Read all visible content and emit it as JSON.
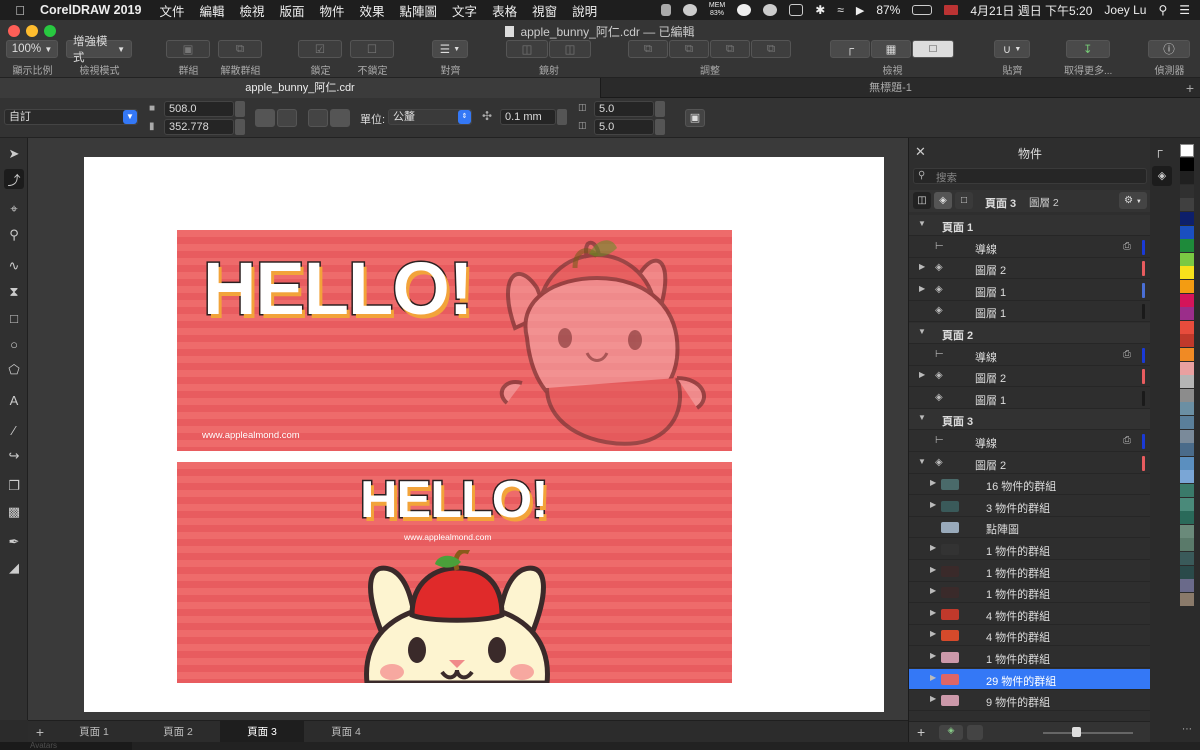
{
  "menubar": {
    "app_name": "CorelDRAW 2019",
    "menus": [
      "文件",
      "編輯",
      "檢視",
      "版面",
      "物件",
      "效果",
      "點陣圖",
      "文字",
      "表格",
      "視窗",
      "說明"
    ],
    "battery": "87%",
    "clock": "4月21日 週日 下午5:20",
    "user": "Joey Lu",
    "mem_label": "MEM",
    "mem_value": "83%"
  },
  "window": {
    "title": "apple_bunny_阿仁.cdr — 已編輯"
  },
  "toolbar": {
    "zoom_value": "100%",
    "zoom_label": "顯示比例",
    "view_mode_value": "增強模式",
    "view_mode_label": "檢視模式",
    "group_label": "群組",
    "ungroup_label": "解散群組",
    "lock_label": "鎖定",
    "unlock_label": "不鎖定",
    "align_label": "對齊",
    "mirror_label": "鏡射",
    "adjust_label": "調整",
    "view_label": "檢視",
    "snap_label": "貼齊",
    "get_more_label": "取得更多...",
    "inspector_label": "偵測器"
  },
  "doc_tabs": [
    "apple_bunny_阿仁.cdr",
    "無標題-1"
  ],
  "propbar": {
    "preset": "自訂",
    "width": "508.0",
    "height": "352.778",
    "unit_label": "單位:",
    "unit_value": "公釐",
    "nudge": "0.1 mm",
    "dup_x": "5.0",
    "dup_y": "5.0"
  },
  "canvas": {
    "banner1": {
      "hello": "HELLO!",
      "url": "www.applealmond.com"
    },
    "banner2": {
      "hello": "HELLO!",
      "url": "www.applealmond.com"
    }
  },
  "page_tabs": [
    "頁面 1",
    "頁面 2",
    "頁面 3",
    "頁面 4"
  ],
  "page_tabs_active": 2,
  "status": {
    "avatar_label": "Avatars"
  },
  "panel": {
    "title": "物件",
    "search_placeholder": "搜索",
    "current_page": "頁面 3",
    "current_layer": "圖層 2",
    "rows": [
      {
        "type": "page",
        "label": "頁面 1"
      },
      {
        "type": "guide",
        "label": "導線",
        "color": "#1a3ad6"
      },
      {
        "type": "layer",
        "label": "圖層 2",
        "expand": true,
        "color": "#e85c5f"
      },
      {
        "type": "layer",
        "label": "圖層 1",
        "expand": true,
        "color": "#4a6fd6"
      },
      {
        "type": "layer",
        "label": "圖層 1",
        "expand": false,
        "color": "#1a1a1a"
      },
      {
        "type": "page",
        "label": "頁面 2"
      },
      {
        "type": "guide",
        "label": "導線",
        "color": "#1a3ad6"
      },
      {
        "type": "layer",
        "label": "圖層 2",
        "expand": true,
        "color": "#e85c5f"
      },
      {
        "type": "layer",
        "label": "圖層 1",
        "expand": false,
        "color": "#1a1a1a"
      },
      {
        "type": "page",
        "label": "頁面 3"
      },
      {
        "type": "guide",
        "label": "導線",
        "color": "#1a3ad6"
      },
      {
        "type": "layer-open",
        "label": "圖層 2",
        "color": "#e85c5f"
      },
      {
        "type": "obj",
        "label": "16 物件的群組",
        "thumb": "#4a6a6a"
      },
      {
        "type": "obj",
        "label": "3 物件的群組",
        "thumb": "#3a5a5a"
      },
      {
        "type": "obj-noexp",
        "label": "點陣圖",
        "thumb": "#9ab"
      },
      {
        "type": "obj",
        "label": "1 物件的群組",
        "thumb": "#333"
      },
      {
        "type": "obj",
        "label": "1 物件的群組",
        "thumb": "#3a2a2a"
      },
      {
        "type": "obj",
        "label": "1 物件的群組",
        "thumb": "#3a2a2a"
      },
      {
        "type": "obj",
        "label": "4 物件的群組",
        "thumb": "#c0392b"
      },
      {
        "type": "obj",
        "label": "4 物件的群組",
        "thumb": "#d64a2b"
      },
      {
        "type": "obj",
        "label": "1 物件的群組",
        "thumb": "#c9a"
      },
      {
        "type": "obj-sel",
        "label": "29 物件的群組",
        "thumb": "#d66"
      },
      {
        "type": "obj",
        "label": "9 物件的群組",
        "thumb": "#c9a"
      }
    ]
  },
  "palette": [
    "#ffffff",
    "#000000",
    "#202020",
    "#303030",
    "#404040",
    "#0d1f6b",
    "#1a4fbf",
    "#1e8a3a",
    "#7ac943",
    "#f7e11b",
    "#f39c12",
    "#d4145a",
    "#9b2d8a",
    "#e74c3c",
    "#c0392b",
    "#f08a24",
    "#e9a0a0",
    "#b5b5b5",
    "#8c8c8c",
    "#6b8fa3",
    "#5a7f9a",
    "#7a8a9a",
    "#4a6b8a",
    "#5b8fbf",
    "#7aa6d6",
    "#3a7a6a",
    "#4a8a7a",
    "#2a6a5a",
    "#6a8a7a",
    "#5a7a6a",
    "#3a5a5a",
    "#2a4a4a",
    "#6a6a8a",
    "#8a7a6a"
  ]
}
